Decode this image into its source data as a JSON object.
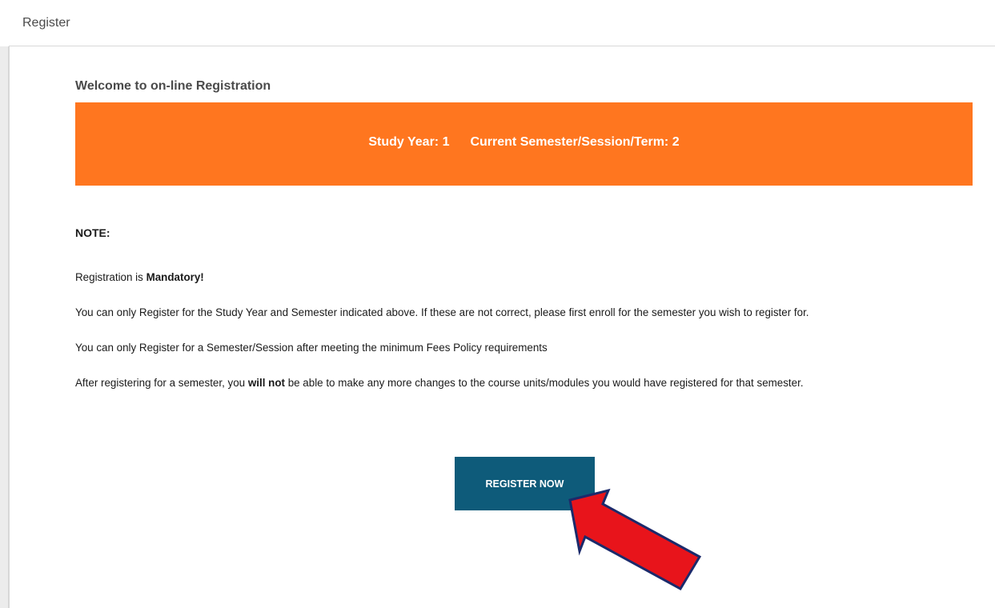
{
  "header": {
    "title": "Register"
  },
  "main": {
    "welcome_title": "Welcome to on-line Registration",
    "banner": {
      "study_year": "Study Year: 1",
      "current_term": "Current Semester/Session/Term: 2",
      "color": "#ff761f"
    },
    "note": {
      "title": "NOTE:",
      "line1_prefix": "Registration is ",
      "line1_bold": "Mandatory!",
      "line2": "You can only Register for the Study Year and Semester indicated above. If these are not correct, please first enroll for the semester you wish to register for.",
      "line3": "You can only Register for a Semester/Session after meeting the minimum Fees Policy requirements",
      "line4_prefix": "After registering for a semester, you ",
      "line4_bold": "will not",
      "line4_suffix": " be able to make any more changes to the course units/modules you would have registered for that semester."
    },
    "register_button": {
      "label": "REGISTER NOW",
      "color": "#0e5b7a"
    },
    "annotation_arrow": {
      "color": "#e8141b",
      "outline": "#1b2a6b",
      "icon": "red-arrow-icon"
    }
  }
}
